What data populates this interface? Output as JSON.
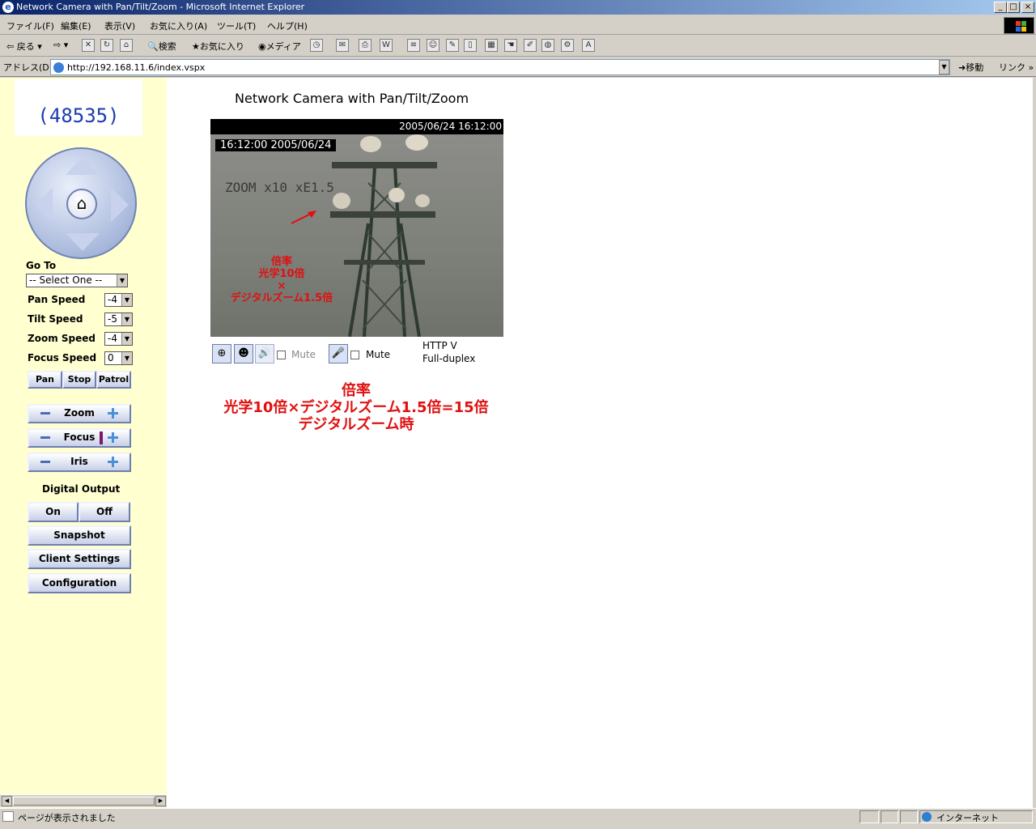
{
  "window": {
    "title": "Network Camera with Pan/Tilt/Zoom - Microsoft Internet Explorer"
  },
  "menu": [
    "ファイル(F)",
    "編集(E)",
    "表示(V)",
    "お気に入り(A)",
    "ツール(T)",
    "ヘルプ(H)"
  ],
  "toolbar": {
    "back": "戻る",
    "search": "検索",
    "favorites": "お気に入り",
    "media": "メディア"
  },
  "address": {
    "label": "アドレス(D)",
    "url": "http://192.168.11.6/index.vspx",
    "go": "移動",
    "links": "リンク"
  },
  "sidebar": {
    "counter": "(48535)",
    "goto_label": "Go To",
    "goto_value": "-- Select One --",
    "pan_speed_label": "Pan Speed",
    "pan_speed": "-4",
    "tilt_speed_label": "Tilt Speed",
    "tilt_speed": "-5",
    "zoom_speed_label": "Zoom Speed",
    "zoom_speed": "-4",
    "focus_speed_label": "Focus Speed",
    "focus_speed": "0",
    "pan": "Pan",
    "stop": "Stop",
    "patrol": "Patrol",
    "zoom": "Zoom",
    "focus": "Focus",
    "iris": "Iris",
    "digital_output": "Digital Output",
    "on": "On",
    "off": "Off",
    "snapshot": "Snapshot",
    "client_settings": "Client Settings",
    "configuration": "Configuration"
  },
  "main": {
    "heading": "Network Camera with Pan/Tilt/Zoom",
    "video_timestamp": "2005/06/24 16:12:00",
    "osd_time": "16:12:00  2005/06/24",
    "osd_zoom": "ZOOM x10 xE1.5",
    "annotation_lines": [
      "倍率",
      "光学10倍",
      "×",
      "デジタルズーム1.5倍"
    ],
    "mute1": "Mute",
    "mute2": "Mute",
    "protocol": "HTTP    V",
    "duplex": "Full-duplex",
    "caption_lines": [
      "倍率",
      "光学10倍×デジタルズーム1.5倍=15倍",
      "デジタルズーム時"
    ]
  },
  "status": {
    "left": "ページが表示されました",
    "zone": "インターネット"
  }
}
